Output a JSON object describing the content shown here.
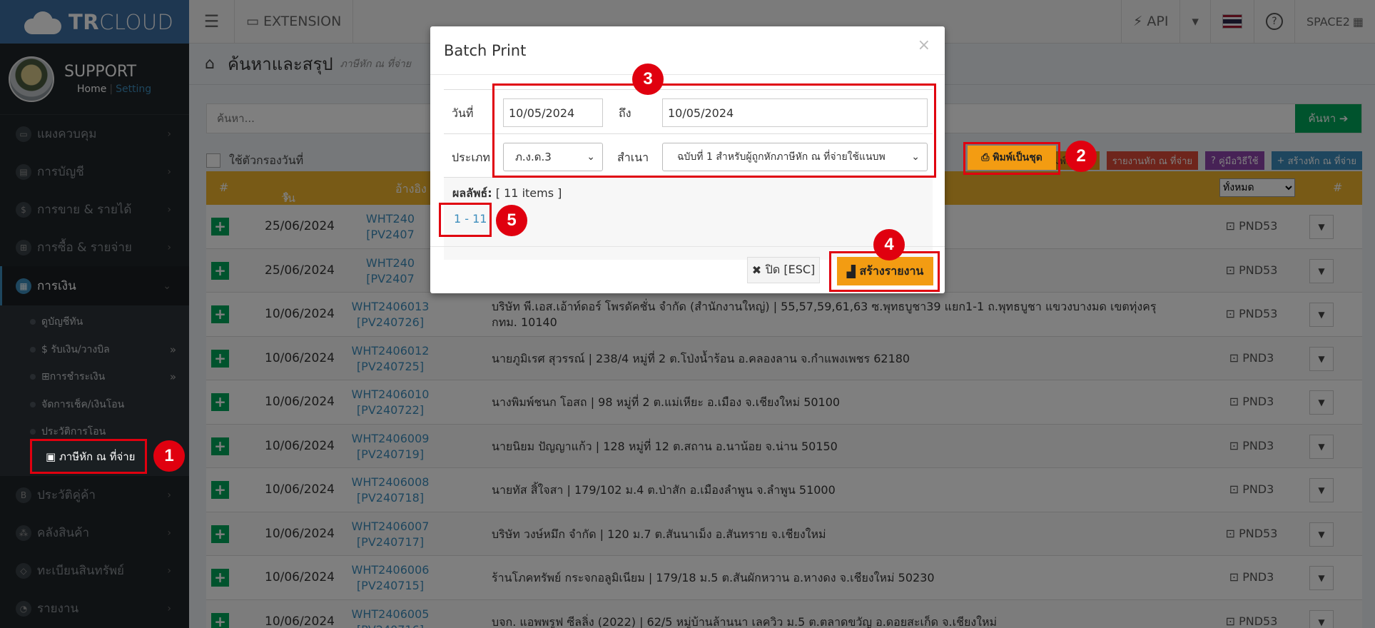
{
  "app": {
    "brand_bold": "TR",
    "brand_light": "CLOUD"
  },
  "user": {
    "name": "SUPPORT",
    "home_link": "Home",
    "separator": "|",
    "setting_link": "Setting"
  },
  "topbar": {
    "extension_label": "EXTENSION",
    "api_label": "API",
    "space_label": "SPACE2"
  },
  "sidebar": {
    "items": [
      {
        "label": "แผงควบคุม",
        "icon": "monitor-icon"
      },
      {
        "label": "การบัญชี",
        "icon": "book-icon"
      },
      {
        "label": "การขาย & รายได้",
        "icon": "dollar-icon"
      },
      {
        "label": "การซื้อ & รายจ่าย",
        "icon": "cart-icon"
      },
      {
        "label": "การเงิน",
        "icon": "calendar-icon"
      },
      {
        "label": "ประวัติคู่ค้า",
        "icon": "b-icon"
      },
      {
        "label": "คลังสินค้า",
        "icon": "cubes-icon"
      },
      {
        "label": "ทะเบียนสินทรัพย์",
        "icon": "diamond-icon"
      },
      {
        "label": "รายงาน",
        "icon": "chart-icon"
      }
    ],
    "submenu": [
      {
        "label": "ดูบัญชีทัน"
      },
      {
        "label": "$ รับเงิน/วางบิล"
      },
      {
        "label": "การชำระเงิน"
      },
      {
        "label": "จัดการเช็ค/เงินโอน"
      },
      {
        "label": "ประวัติการโอน"
      },
      {
        "label": "ภาษีหัก ณ ที่จ่าย"
      }
    ]
  },
  "page": {
    "title": "ค้นหาและสรุป",
    "subtitle": "ภาษีหัก ณ ที่จ่าย",
    "search_placeholder": "ค้นหา...",
    "search_button": "ค้นหา",
    "filter_label": "ใช้ตัวกรองวันที่",
    "actions": {
      "print_batch": "พิมพ์เป็นชุด",
      "report": "รายงานหัก ณ ที่จ่าย",
      "manual": "คู่มือวิธีใช้",
      "create": "สร้างหัก ณ ที่จ่าย"
    },
    "table_headers": {
      "hash": "#",
      "date": "วันที่",
      "ref": "อ้างอิง",
      "hash2": "#"
    },
    "type_filter": "ทั้งหมด"
  },
  "rows": [
    {
      "date": "25/06/2024",
      "doc": "WHT240",
      "pv": "[PV2407",
      "desc": "",
      "type": "PND53"
    },
    {
      "date": "25/06/2024",
      "doc": "WHT240",
      "pv": "[PV2407",
      "desc": "",
      "type": "PND53"
    },
    {
      "date": "10/06/2024",
      "doc": "WHT2406013",
      "pv": "[PV240726]",
      "desc": "บริษัท พี.เอส.เอ้าท์ดอร์ โพรดัคชั่น จำกัด (สำนักงานใหญ่) | 55,57,59,61,63 ซ.พุทธบูชา39 แยก1-1 ถ.พุทธบูชา แขวงบางมด เขตทุ่งครุ กทม. 10140",
      "type": "PND53"
    },
    {
      "date": "10/06/2024",
      "doc": "WHT2406012",
      "pv": "[PV240725]",
      "desc": "นายภูมิเรศ สุวรรณ์ | 238/4 หมู่ที่ 2 ต.โป่งน้ำร้อน อ.คลองลาน จ.กำแพงเพชร 62180",
      "type": "PND3"
    },
    {
      "date": "10/06/2024",
      "doc": "WHT2406010",
      "pv": "[PV240722]",
      "desc": "นางพิมพ์ชนก โอสถ | 98 หมู่ที่ 2 ต.แม่เหียะ อ.เมือง จ.เชียงใหม่ 50100",
      "type": "PND3"
    },
    {
      "date": "10/06/2024",
      "doc": "WHT2406009",
      "pv": "[PV240719]",
      "desc": "นายนิยม ปัญญาแก้ว | 128 หมู่ที่ 12 ต.สถาน อ.นาน้อย จ.น่าน 50150",
      "type": "PND3"
    },
    {
      "date": "10/06/2024",
      "doc": "WHT2406008",
      "pv": "[PV240718]",
      "desc": "นายทัส สิ้ใจสา | 179/102 ม.4 ต.ป่าสัก อ.เมืองลำพูน จ.ลำพูน 51000",
      "type": "PND3"
    },
    {
      "date": "10/06/2024",
      "doc": "WHT2406007",
      "pv": "[PV240717]",
      "desc": "บริษัท วงษ์หมึก จำกัด | 120 ม.7 ต.สันนาเม็ง อ.สันทราย จ.เชียงใหม่",
      "type": "PND53"
    },
    {
      "date": "10/06/2024",
      "doc": "WHT2406006",
      "pv": "[PV240715]",
      "desc": "ร้านโภคทรัพย์ กระจกอลูมิเนียม | 179/18 ม.5 ต.สันผักหวาน อ.หางดง จ.เชียงใหม่ 50230",
      "type": "PND3"
    },
    {
      "date": "10/06/2024",
      "doc": "WHT2406005",
      "pv": "[PV240716]",
      "desc": "บจก. แอพพรูฟ ซีลลิ่ง (2022) | 62/5 หมู่บ้านล้านนา เลควิว ม.5 ต.ตลาดขวัญ อ.ดอยสะเก็ด จ.เชียงใหม่",
      "type": "PND53"
    }
  ],
  "modal": {
    "title": "Batch Print",
    "close_x": "×",
    "date_label": "วันที่",
    "date_from": "10/05/2024",
    "to_label": "ถึง",
    "date_to": "10/05/2024",
    "type_label": "ประเภท",
    "type_value": "ภ.ง.ด.3",
    "copy_label": "สำเนา",
    "copy_value": "ฉบับที่ 1 สำหรับผู้ถูกหักภาษีหัก ณ ที่จ่ายใช้แนบพ",
    "results_label": "ผลลัพธ์:",
    "results_count": "[ 11 items ]",
    "page_link": "1 - 11",
    "close_button": "ปิด [ESC]",
    "create_button": "สร้างรายงาน"
  },
  "annotations": [
    "1",
    "2",
    "3",
    "4",
    "5"
  ]
}
